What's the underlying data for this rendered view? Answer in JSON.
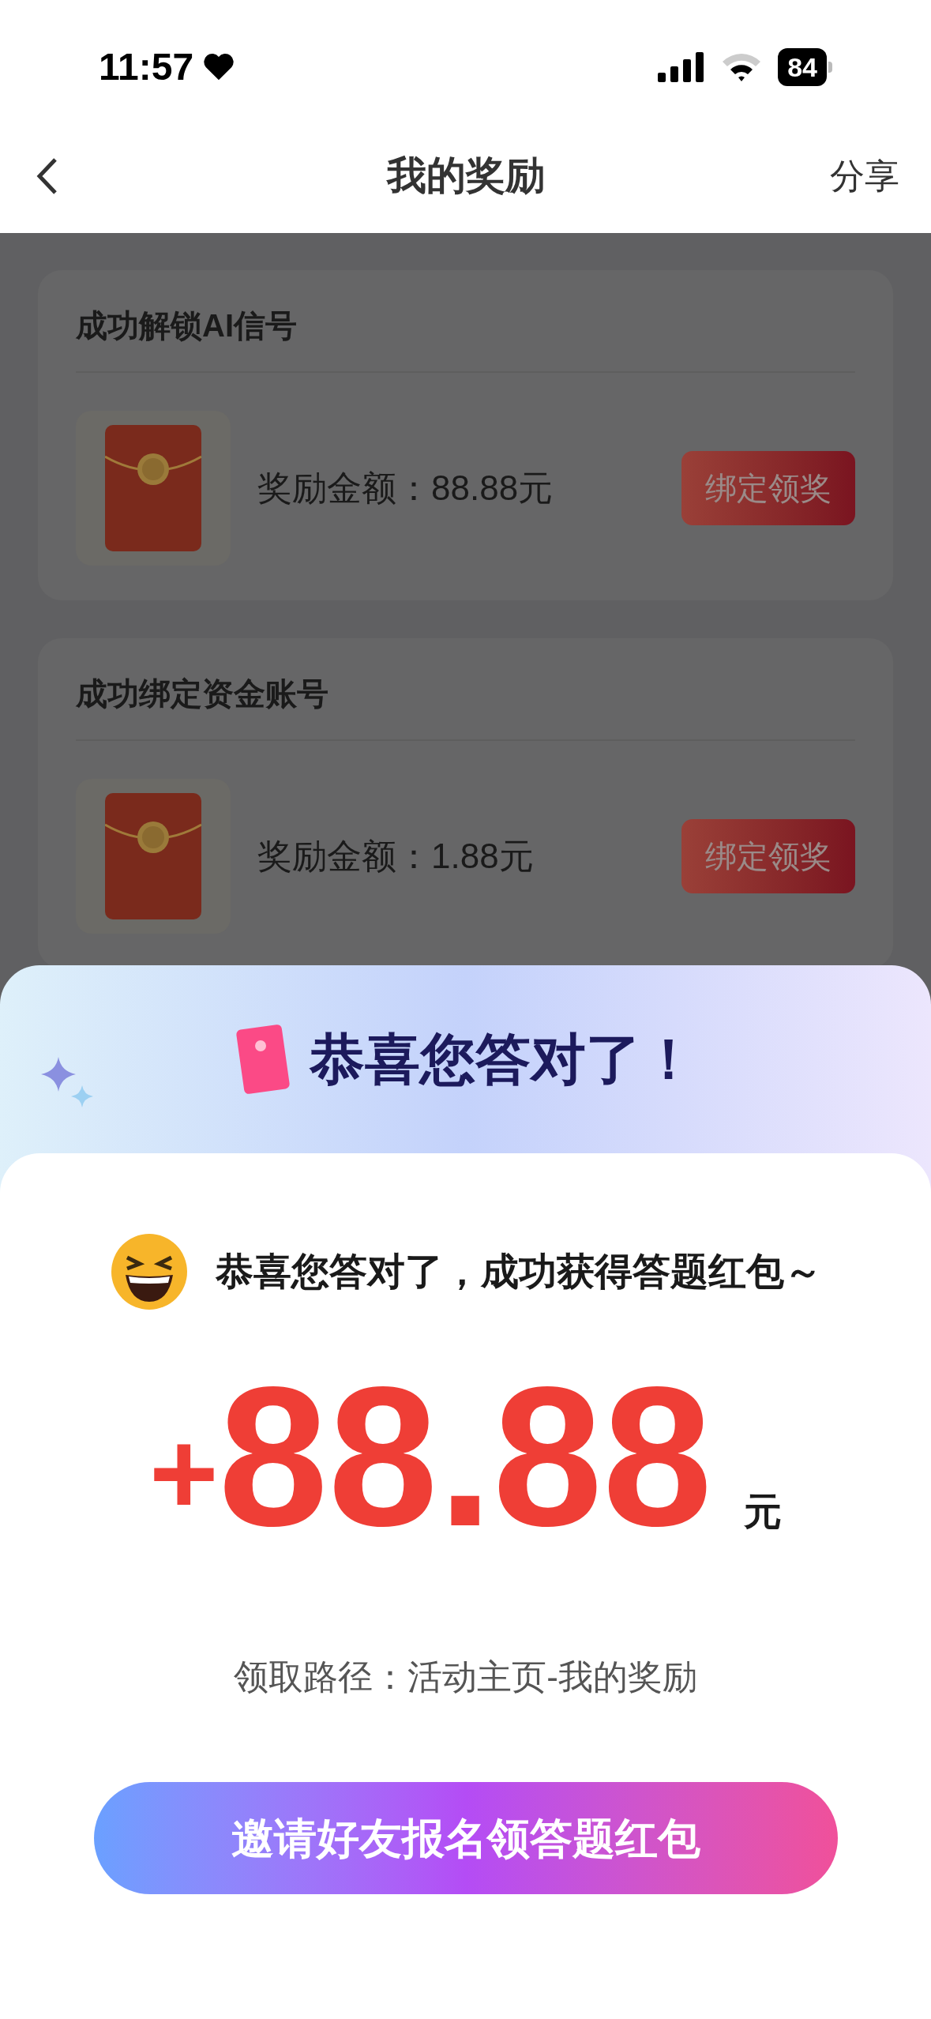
{
  "status_bar": {
    "time": "11:57",
    "battery": "84"
  },
  "nav": {
    "title": "我的奖励",
    "action": "分享"
  },
  "rewards": [
    {
      "title": "成功解锁AI信号",
      "amount": "奖励金额：88.88元",
      "button": "绑定领奖"
    },
    {
      "title": "成功绑定资金账号",
      "amount": "奖励金额：1.88元",
      "button": "绑定领奖"
    }
  ],
  "dialog": {
    "banner_title": "恭喜您答对了！",
    "message": "恭喜您答对了，成功获得答题红包～",
    "amount_sign": "+",
    "amount": "88.88",
    "unit": "元",
    "path": "领取路径：活动主页-我的奖励",
    "button": "邀请好友报名领答题红包"
  }
}
